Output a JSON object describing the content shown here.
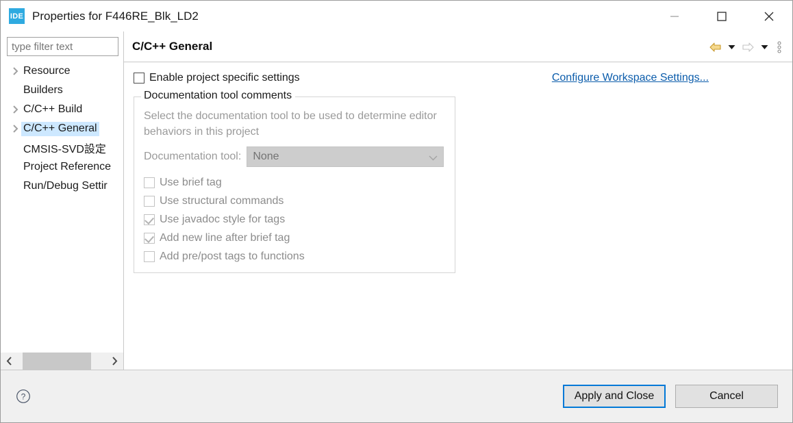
{
  "window": {
    "app_icon_text": "IDE",
    "title": "Properties for F446RE_Blk_LD2",
    "controls": {
      "minimize": "minimize-button",
      "maximize": "maximize-button",
      "close": "close-button"
    }
  },
  "sidebar": {
    "filter": {
      "value": "",
      "placeholder": "type filter text"
    },
    "items": [
      {
        "label": "Resource",
        "expandable": true,
        "selected": false
      },
      {
        "label": "Builders",
        "expandable": false,
        "selected": false
      },
      {
        "label": "C/C++ Build",
        "expandable": true,
        "selected": false
      },
      {
        "label": "C/C++ General",
        "expandable": true,
        "selected": true
      },
      {
        "label": "CMSIS-SVD設定",
        "expandable": false,
        "selected": false
      },
      {
        "label": "Project Reference",
        "expandable": false,
        "selected": false
      },
      {
        "label": "Run/Debug Settir",
        "expandable": false,
        "selected": false
      }
    ],
    "scroll_left_label": "scroll-left",
    "scroll_right_label": "scroll-right"
  },
  "page": {
    "title": "C/C++ General",
    "nav": {
      "back": "back-arrow",
      "back_menu": "back-dropdown",
      "forward": "forward-arrow",
      "forward_menu": "forward-dropdown",
      "view_menu": "view-menu"
    },
    "enable_project_specific": {
      "label": "Enable project specific settings",
      "checked": false,
      "enabled": true
    },
    "workspace_link": "Configure Workspace Settings...",
    "group": {
      "title": "Documentation tool comments",
      "description": "Select the documentation tool to be used to determine editor behaviors in this project",
      "doc_tool_label": "Documentation tool:",
      "doc_tool_value": "None",
      "doc_tool_options": [
        "None"
      ],
      "checkboxes": [
        {
          "label": "Use brief tag",
          "checked": false
        },
        {
          "label": "Use structural commands",
          "checked": false
        },
        {
          "label": "Use javadoc style for tags",
          "checked": true
        },
        {
          "label": "Add new line after brief tag",
          "checked": true
        },
        {
          "label": "Add pre/post tags to functions",
          "checked": false
        }
      ]
    }
  },
  "footer": {
    "help": "help-icon",
    "apply_and_close": "Apply and Close",
    "cancel": "Cancel"
  },
  "colors": {
    "accent": "#0078d7",
    "selection": "#cde8ff",
    "link": "#0b5cab",
    "icon_blue": "#2eaae0",
    "back_arrow": "#e8b33a"
  }
}
